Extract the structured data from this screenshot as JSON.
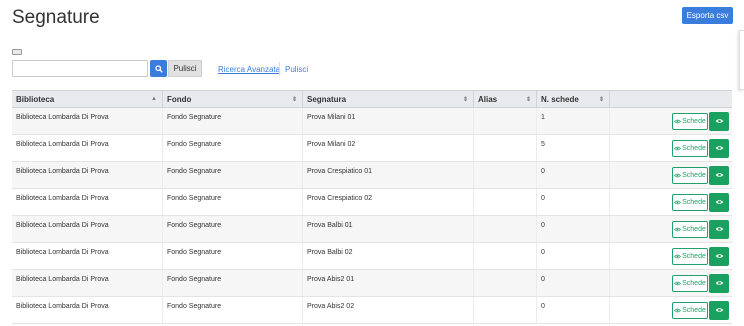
{
  "page": {
    "title": "Segnature"
  },
  "toolbar": {
    "export_label": "Esporta csv"
  },
  "search": {
    "placeholder": "",
    "value": "",
    "search_icon": "search-icon",
    "clear_button_label": "Pulisci",
    "advanced_link_label": "Ricerca Avanzata",
    "clear_link_label": "Pulisci"
  },
  "table": {
    "columns": [
      "Biblioteca",
      "Fondo",
      "Segnatura",
      "Alias",
      "N. schede",
      ""
    ],
    "schede_label": "Schede",
    "rows": [
      {
        "biblioteca": "Biblioteca Lombarda Di Prova",
        "fondo": "Fondo Segnature",
        "segnatura": "Prova Milani 01",
        "alias": "",
        "n_schede": "1"
      },
      {
        "biblioteca": "Biblioteca Lombarda Di Prova",
        "fondo": "Fondo Segnature",
        "segnatura": "Prova Milani 02",
        "alias": "",
        "n_schede": "5"
      },
      {
        "biblioteca": "Biblioteca Lombarda Di Prova",
        "fondo": "Fondo Segnature",
        "segnatura": "Prova Crespiatico 01",
        "alias": "",
        "n_schede": "0"
      },
      {
        "biblioteca": "Biblioteca Lombarda Di Prova",
        "fondo": "Fondo Segnature",
        "segnatura": "Prova Crespiatico 02",
        "alias": "",
        "n_schede": "0"
      },
      {
        "biblioteca": "Biblioteca Lombarda Di Prova",
        "fondo": "Fondo Segnature",
        "segnatura": "Prova Balbi 01",
        "alias": "",
        "n_schede": "0"
      },
      {
        "biblioteca": "Biblioteca Lombarda Di Prova",
        "fondo": "Fondo Segnature",
        "segnatura": "Prova Balbi 02",
        "alias": "",
        "n_schede": "0"
      },
      {
        "biblioteca": "Biblioteca Lombarda Di Prova",
        "fondo": "Fondo Segnature",
        "segnatura": "Prova Abis2 01",
        "alias": "",
        "n_schede": "0"
      },
      {
        "biblioteca": "Biblioteca Lombarda Di Prova",
        "fondo": "Fondo Segnature",
        "segnatura": "Prova Abis2 02",
        "alias": "",
        "n_schede": "0"
      }
    ]
  },
  "colors": {
    "primary": "#3b7ddd",
    "success": "#1aa160",
    "header_bg": "#e8eaed"
  }
}
